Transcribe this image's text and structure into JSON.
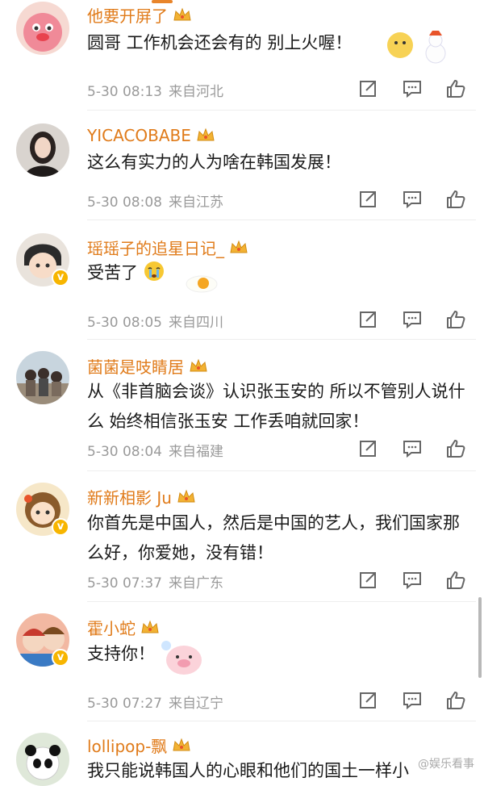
{
  "colors": {
    "username": "#e07b1a",
    "meta": "#9a9a9a",
    "badge": "#f7b500"
  },
  "comments": [
    {
      "username": "他要开屏了",
      "text": "圆哥 工作机会还会有的 别上火喔！",
      "date": "5-30 08:13",
      "location": "来自河北",
      "avatar_icon": "pink-character-avatar",
      "verified": false,
      "sticker": "snowman-emoji"
    },
    {
      "username": "YICACOBABE",
      "text": "这么有实力的人为啥在韩国发展！",
      "date": "5-30 08:08",
      "location": "来自江苏",
      "avatar_icon": "girl-photo-avatar",
      "verified": false
    },
    {
      "username": "瑶瑶子的追星日记_",
      "text": "受苦了",
      "date": "5-30 08:05",
      "location": "来自四川",
      "avatar_icon": "cartoon-boy-avatar",
      "verified": true,
      "sticker": "fried-egg-emoji"
    },
    {
      "username": "菌菌是吱睛居",
      "text": "从《非首脑会谈》认识张玉安的 所以不管别人说什么 始终相信张玉安 工作丢咱就回家！",
      "date": "5-30 08:04",
      "location": "来自福建",
      "avatar_icon": "group-photo-avatar",
      "verified": false
    },
    {
      "username": "新新相影 Ju",
      "text": "你首先是中国人，然后是中国的艺人，我们国家那么好，你爱她，没有错！",
      "date": "5-30 07:37",
      "location": "来自广东",
      "avatar_icon": "cartoon-girl-avatar",
      "verified": true
    },
    {
      "username": "霍小蛇",
      "text": "支持你！",
      "date": "5-30 07:27",
      "location": "来自辽宁",
      "avatar_icon": "anime-avatar",
      "verified": true,
      "sticker": "pig-emoji"
    },
    {
      "username": "lollipop-飘",
      "text": "我只能说韩国人的心眼和他们的国土一样小",
      "avatar_icon": "panda-avatar",
      "verified": false
    }
  ],
  "actions": {
    "share_icon": "share-icon",
    "comment_icon": "comment-icon",
    "like_icon": "like-icon"
  },
  "watermark": "@娱乐看事"
}
